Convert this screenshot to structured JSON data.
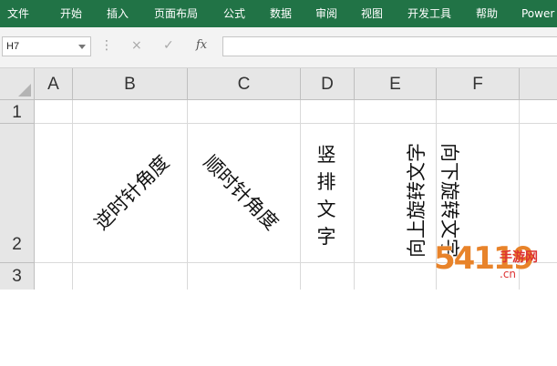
{
  "ribbon": {
    "tabs": [
      "文件",
      "开始",
      "插入",
      "页面布局",
      "公式",
      "数据",
      "审阅",
      "视图",
      "开发工具",
      "帮助",
      "Power"
    ]
  },
  "formula_bar": {
    "name_box": "H7",
    "cancel_icon": "×",
    "enter_icon": "✓",
    "fx_label": "fx",
    "formula_value": ""
  },
  "sheet": {
    "columns": [
      "A",
      "B",
      "C",
      "D",
      "E",
      "F"
    ],
    "rows": [
      "1",
      "2",
      "3"
    ],
    "cells": {
      "B2": "逆时针角度",
      "C2": "顺时针角度",
      "D2": "竖排文字",
      "E2": "向上旋转文字",
      "F2": "向下旋转文字"
    }
  },
  "watermark": {
    "number": "54119",
    "site": "手游网",
    "domain": ".cn"
  },
  "colors": {
    "ribbon": "#217346",
    "header": "#e6e6e6",
    "gridline": "#d9d9d9"
  }
}
